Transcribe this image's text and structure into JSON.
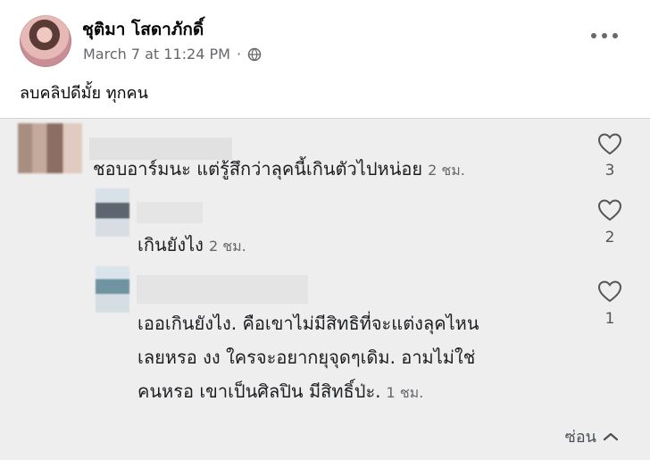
{
  "post": {
    "author": "ชุติมา โสดาภักดิ์",
    "date": "March 7 at 11:24 PM",
    "separator": "·",
    "caption": "ลบคลิปดีมั้ย ทุกคน"
  },
  "comments": [
    {
      "text": "ชอบอาร์มนะ แต่รู้สึกว่าลุคนี้เกินตัวไปหน่อย",
      "time": "2 ชม.",
      "likes": "3"
    },
    {
      "text": "เกินยังไง",
      "time": "2 ชม.",
      "likes": "2"
    },
    {
      "lines": [
        "เออเกินยังไง. คือเขาไม่มีสิทธิที่จะแต่งลุคไหน",
        "เลยหรอ งง ใครจะอยากยุจุดๆเดิม. อามไม่ใช่",
        "คนหรอ เขาเป็นศิลปิน มีสิทธิ์ป่ะ."
      ],
      "time": "1 ชม.",
      "likes": "1"
    }
  ],
  "controls": {
    "hide_label": "ซ่อน"
  },
  "icons": {
    "globe": "globe-icon",
    "more": "more-options-icon",
    "heart": "heart-outline-icon",
    "chevron": "chevron-up-icon"
  },
  "colors": {
    "text": "#1c1e21",
    "meta": "#65676b",
    "thread_bg": "#eeeeee"
  }
}
